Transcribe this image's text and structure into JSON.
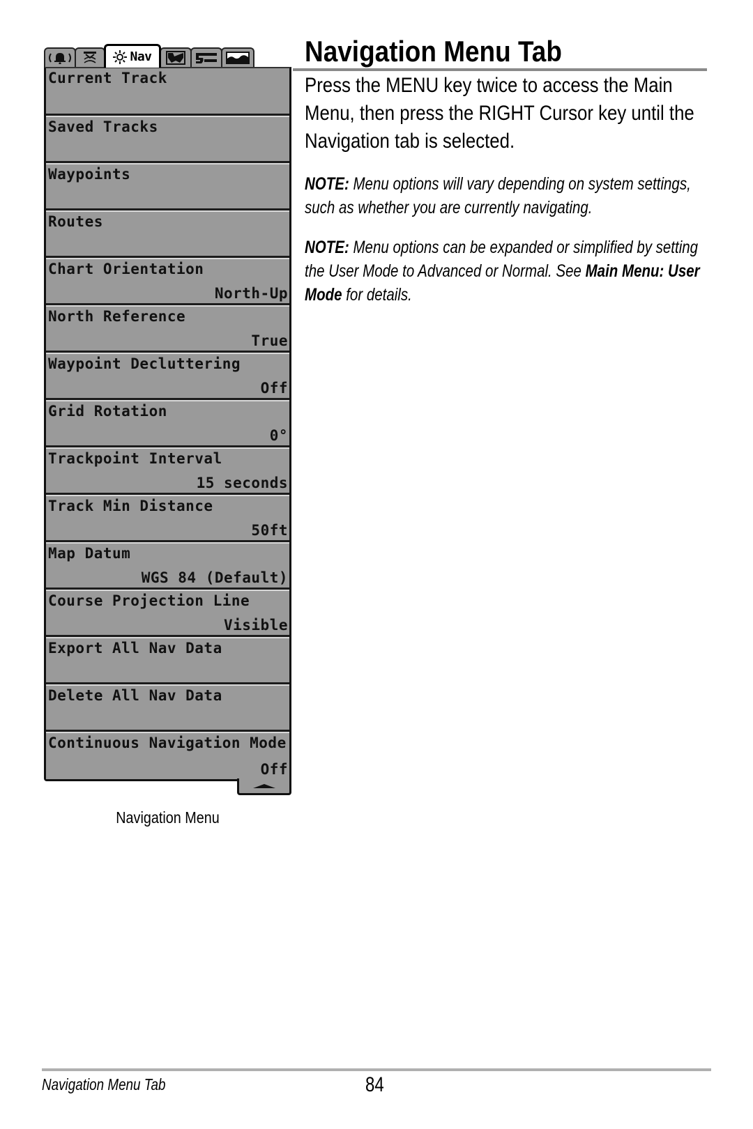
{
  "page": {
    "heading": "Navigation Menu Tab",
    "intro": "Press the MENU key twice to access the Main Menu, then press the RIGHT Cursor key until the Navigation tab is selected.",
    "note1": {
      "label": "NOTE:",
      "text": " Menu options will vary depending on system settings, such as whether you are currently navigating."
    },
    "note2": {
      "label": "NOTE:",
      "text": " Menu options can be expanded or simplified by setting the User Mode to Advanced or Normal. See ",
      "link": "Main Menu: User Mode",
      "tail": " for details."
    }
  },
  "device_menu": {
    "tabs": [
      {
        "id": "alarms",
        "icon": "alarm-bell-icon",
        "label": "",
        "active": false
      },
      {
        "id": "sonar",
        "icon": "sonar-icon",
        "label": "",
        "active": false
      },
      {
        "id": "navigation",
        "icon": "sun-nav-icon",
        "label": "Nav",
        "active": true
      },
      {
        "id": "chart",
        "icon": "chart-map-icon",
        "label": "",
        "active": false
      },
      {
        "id": "setup",
        "icon": "wrench-setup-icon",
        "label": "",
        "active": false
      },
      {
        "id": "views",
        "icon": "views-icon",
        "label": "",
        "active": false
      }
    ],
    "items": [
      {
        "label": "Current Track",
        "value": ""
      },
      {
        "label": "Saved Tracks",
        "value": ""
      },
      {
        "label": "Waypoints",
        "value": ""
      },
      {
        "label": "Routes",
        "value": ""
      },
      {
        "label": "Chart Orientation",
        "value": "North-Up"
      },
      {
        "label": "North Reference",
        "value": "True"
      },
      {
        "label": "Waypoint Decluttering",
        "value": "Off"
      },
      {
        "label": "Grid Rotation",
        "value": "0°"
      },
      {
        "label": "Trackpoint Interval",
        "value": "15 seconds"
      },
      {
        "label": "Track Min Distance",
        "value": "50ft"
      },
      {
        "label": "Map Datum",
        "value": "WGS 84 (Default)"
      },
      {
        "label": "Course Projection Line",
        "value": "Visible"
      },
      {
        "label": "Export All Nav Data",
        "value": ""
      },
      {
        "label": "Delete All Nav Data",
        "value": ""
      },
      {
        "label": "Continuous Navigation Mode",
        "value": "Off"
      }
    ],
    "scroll_indicator": "scroll-up-arrow",
    "caption": "Navigation Menu"
  },
  "footer": {
    "section": "Navigation Menu Tab",
    "page_number": "84"
  },
  "colors": {
    "menu_fill": "#9a9a9a",
    "menu_border": "#111111",
    "active_tab": "#ffffff",
    "rule": "#8a8a8a"
  }
}
